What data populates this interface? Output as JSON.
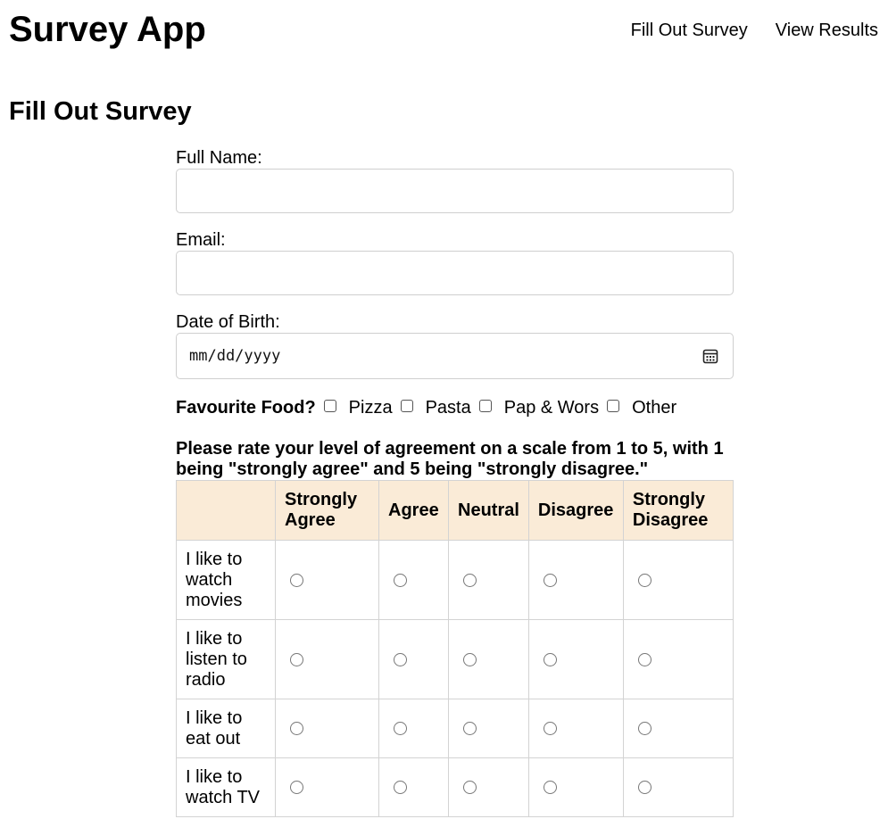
{
  "header": {
    "title": "Survey App",
    "nav": [
      {
        "label": "Fill Out Survey"
      },
      {
        "label": "View Results"
      }
    ]
  },
  "page_title": "Fill Out Survey",
  "form": {
    "full_name": {
      "label": "Full Name:",
      "value": "",
      "placeholder": ""
    },
    "email": {
      "label": "Email:",
      "value": "",
      "placeholder": ""
    },
    "dob": {
      "label": "Date of Birth:",
      "placeholder": "mm/dd/yyyy",
      "icon": "calendar-icon"
    },
    "food": {
      "question": "Favourite Food?",
      "options": [
        {
          "label": "Pizza",
          "checked": false
        },
        {
          "label": "Pasta",
          "checked": false
        },
        {
          "label": "Pap & Wors",
          "checked": false
        },
        {
          "label": "Other",
          "checked": false
        }
      ]
    },
    "rating": {
      "prompt": "Please rate your level of agreement on a scale from 1 to 5, with 1 being \"strongly agree\" and 5 being \"strongly disagree.\"",
      "columns": [
        "",
        "Strongly Agree",
        "Agree",
        "Neutral",
        "Disagree",
        "Strongly Disagree"
      ],
      "rows": [
        {
          "statement": "I like to watch movies"
        },
        {
          "statement": "I like to listen to radio"
        },
        {
          "statement": "I like to eat out"
        },
        {
          "statement": "I like to watch TV"
        }
      ]
    }
  },
  "colors": {
    "table_header_bg": "#faebd7",
    "border": "#cfcfcf"
  }
}
